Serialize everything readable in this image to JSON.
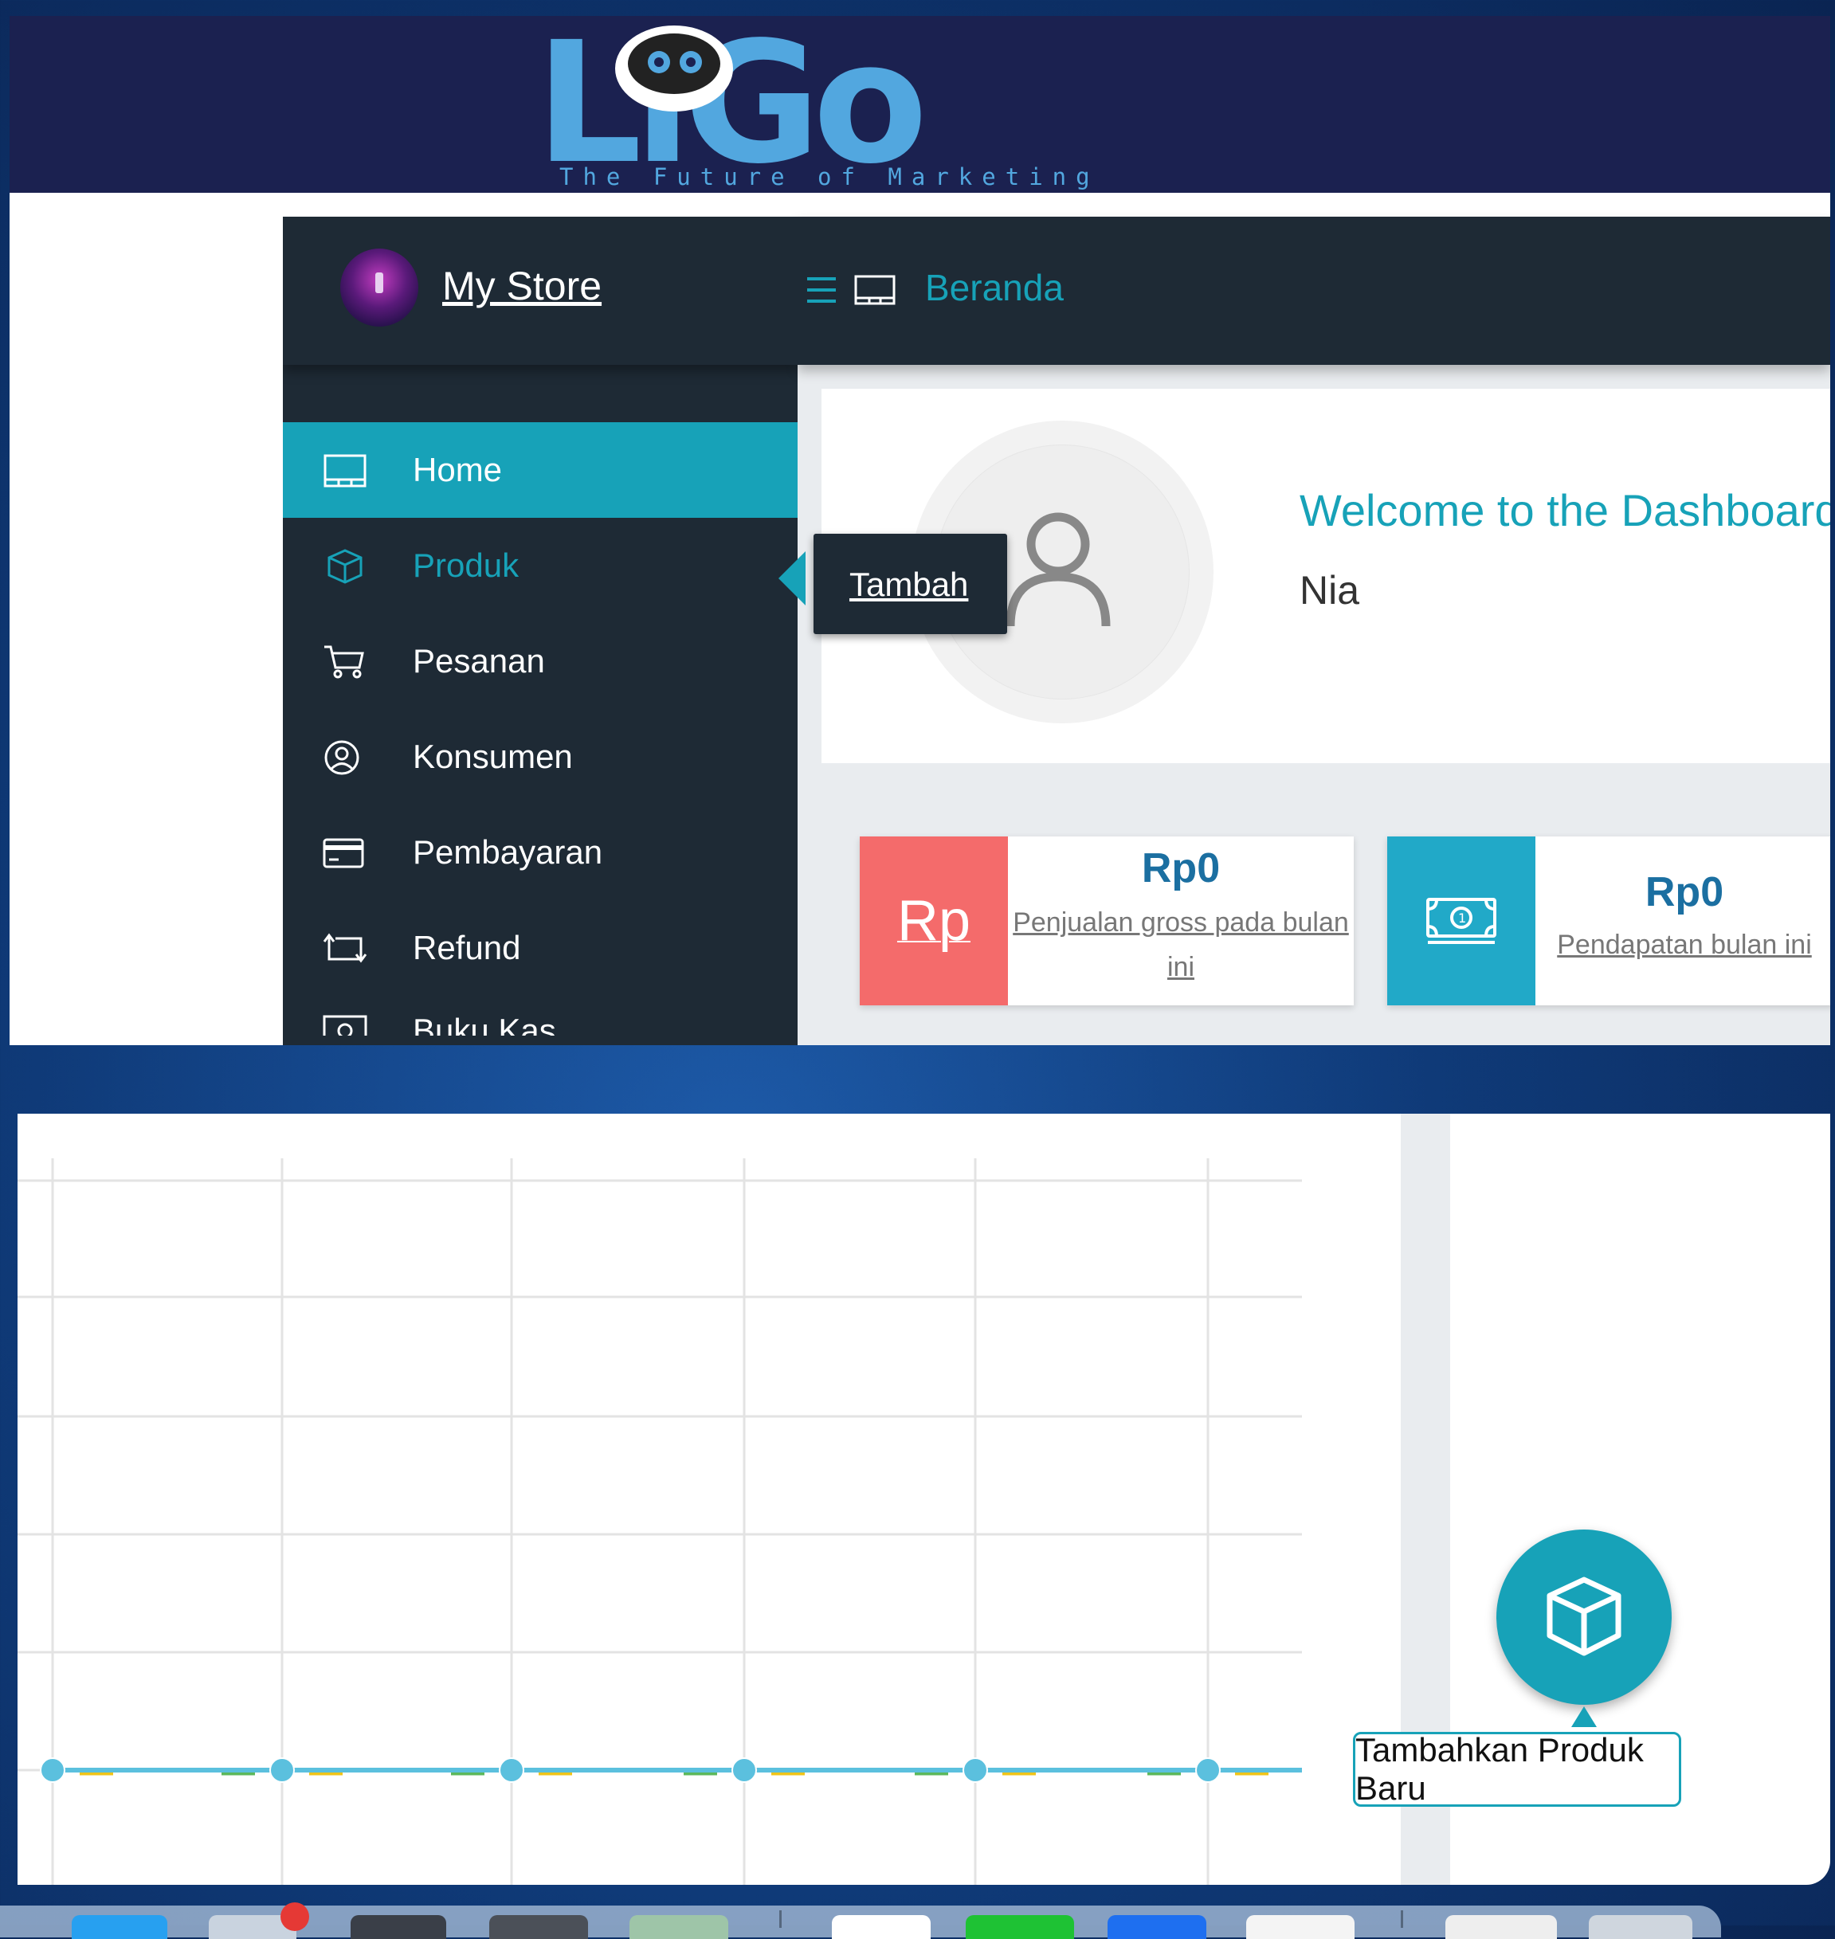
{
  "brand": {
    "logo_text": "LiGo",
    "tagline": "The Future of Marketing"
  },
  "sidebar": {
    "store_name": "My Store",
    "items": [
      {
        "label": "Home",
        "icon": "home-icon",
        "active": true
      },
      {
        "label": "Produk",
        "icon": "box-icon",
        "expanded": true
      },
      {
        "label": "Pesanan",
        "icon": "cart-icon"
      },
      {
        "label": "Konsumen",
        "icon": "user-circle-icon"
      },
      {
        "label": "Pembayaran",
        "icon": "credit-card-icon"
      },
      {
        "label": "Refund",
        "icon": "refund-icon"
      },
      {
        "label": "Buku Kas",
        "icon": "cash-icon"
      }
    ],
    "flyout": {
      "label": "Tambah"
    }
  },
  "topbar": {
    "breadcrumb": "Beranda"
  },
  "welcome": {
    "title": "Welcome to the Dashboard",
    "user": "Nia"
  },
  "stats": [
    {
      "icon_text": "Rp",
      "value": "Rp0",
      "label": "Penjualan gross pada bulan ini",
      "color": "#f46b6b"
    },
    {
      "icon": "money-icon",
      "value": "Rp0",
      "label": "Pendapatan bulan ini",
      "color": "#21a9c8"
    }
  ],
  "fab": {
    "icon": "box-icon",
    "tooltip": "Tambahkan Produk Baru"
  },
  "chart_data": {
    "type": "line",
    "series": [
      {
        "color": "#5bc0de",
        "values": [
          0,
          0,
          0,
          0,
          0,
          0
        ]
      },
      {
        "color": "#5cb85c",
        "values": [
          0,
          0,
          0,
          0,
          0,
          0
        ]
      },
      {
        "color": "#f0c419",
        "values": [
          0,
          0,
          0,
          0,
          0,
          0
        ]
      }
    ],
    "grid": true
  },
  "colors": {
    "accent": "#17a2b8",
    "sidebar": "#1e2a35",
    "banner": "#1b2150"
  }
}
